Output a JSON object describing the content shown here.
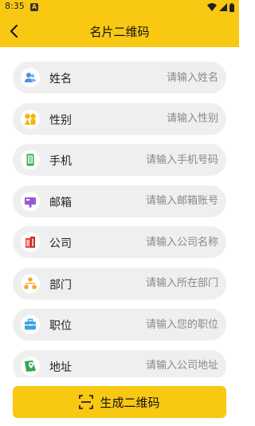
{
  "status_bar": {
    "time": "8:35",
    "notification_icon": "A"
  },
  "header": {
    "title": "名片二维码",
    "back_icon": "chevron-left-icon"
  },
  "form": {
    "fields": [
      {
        "label": "姓名",
        "placeholder": "请输入姓名",
        "value": "",
        "icon": "person-icon"
      },
      {
        "label": "性别",
        "placeholder": "请输入性别",
        "value": "",
        "icon": "gender-icon"
      },
      {
        "label": "手机",
        "placeholder": "请输入手机号码",
        "value": "",
        "icon": "phone-icon"
      },
      {
        "label": "邮箱",
        "placeholder": "请输入邮箱账号",
        "value": "",
        "icon": "mailbox-icon"
      },
      {
        "label": "公司",
        "placeholder": "请输入公司名称",
        "value": "",
        "icon": "building-icon"
      },
      {
        "label": "部门",
        "placeholder": "请输入所在部门",
        "value": "",
        "icon": "org-chart-icon"
      },
      {
        "label": "职位",
        "placeholder": "请输入您的职位",
        "value": "",
        "icon": "briefcase-icon"
      },
      {
        "label": "地址",
        "placeholder": "请输入公司地址",
        "value": "",
        "icon": "map-pin-icon"
      }
    ]
  },
  "footer": {
    "generate_label": "生成二维码",
    "generate_icon": "scan-icon"
  },
  "colors": {
    "accent": "#f8c813",
    "field_bg": "#efefef",
    "person": "#4a90e2",
    "gender": "#f5b400",
    "phone": "#2fb34a",
    "mailbox": "#9b59d0",
    "building": "#e8443a",
    "org_chart": "#f5a623",
    "briefcase": "#3aa3e3",
    "map_pin": "#2fa84f"
  }
}
